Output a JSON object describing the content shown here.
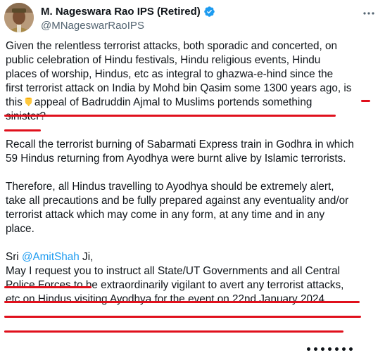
{
  "author": {
    "display_name": "M. Nageswara Rao IPS (Retired)",
    "handle": "@MNageswarRaoIPS",
    "verified": true,
    "verified_color": "#1d9bf0"
  },
  "icons": {
    "verified": "verified-badge-icon",
    "more": "more-horizontal-icon",
    "emoji": "pointing-down-hand-emoji"
  },
  "tweet": {
    "p1": {
      "l1": "Given the relentless terrorist attacks, both sporadic and concerted, on",
      "l2": "public celebration of Hindu festivals, Hindu religious events, Hindu",
      "l3": "places of worship, Hindus, etc as integral to ghazwa-e-hind since the",
      "l4a": "first terrorist attack on India by Mohd bin Qasim some 1300 years ago, ",
      "l4b": "is",
      "l5a": "this",
      "l5b": "appeal of Badruddin Ajmal to Muslims portends something",
      "l6a": "sinister",
      "l6b": "?"
    },
    "p2": {
      "l1": "Recall the terrorist burning of Sabarmati Express train in Godhra in which",
      "l2": "59 Hindus returning from Ayodhya were burnt alive by Islamic terrorists."
    },
    "p3": {
      "l1": "Therefore, all Hindus travelling to Ayodhya should be extremely alert,",
      "l2": "take all precautions and be fully prepared against any eventuality and/or",
      "l3": "terrorist attack which may come in any form, at any time and in any",
      "l4": "place."
    },
    "p4": {
      "sri": "Sri ",
      "mention": "@AmitShah",
      "ji": " Ji,",
      "l2": "May I request you to instruct all State/UT Governments and all Central",
      "l3": "Police Forces to be extraordinarily vigilant to avert any terrorist attacks,",
      "l4": "etc on Hindus visiting Ayodhya for the event on 22nd January 2024."
    }
  },
  "colors": {
    "text": "#0f1419",
    "secondary": "#536471",
    "mention": "#1d9bf0",
    "underline_annotation": "#e0101c"
  }
}
